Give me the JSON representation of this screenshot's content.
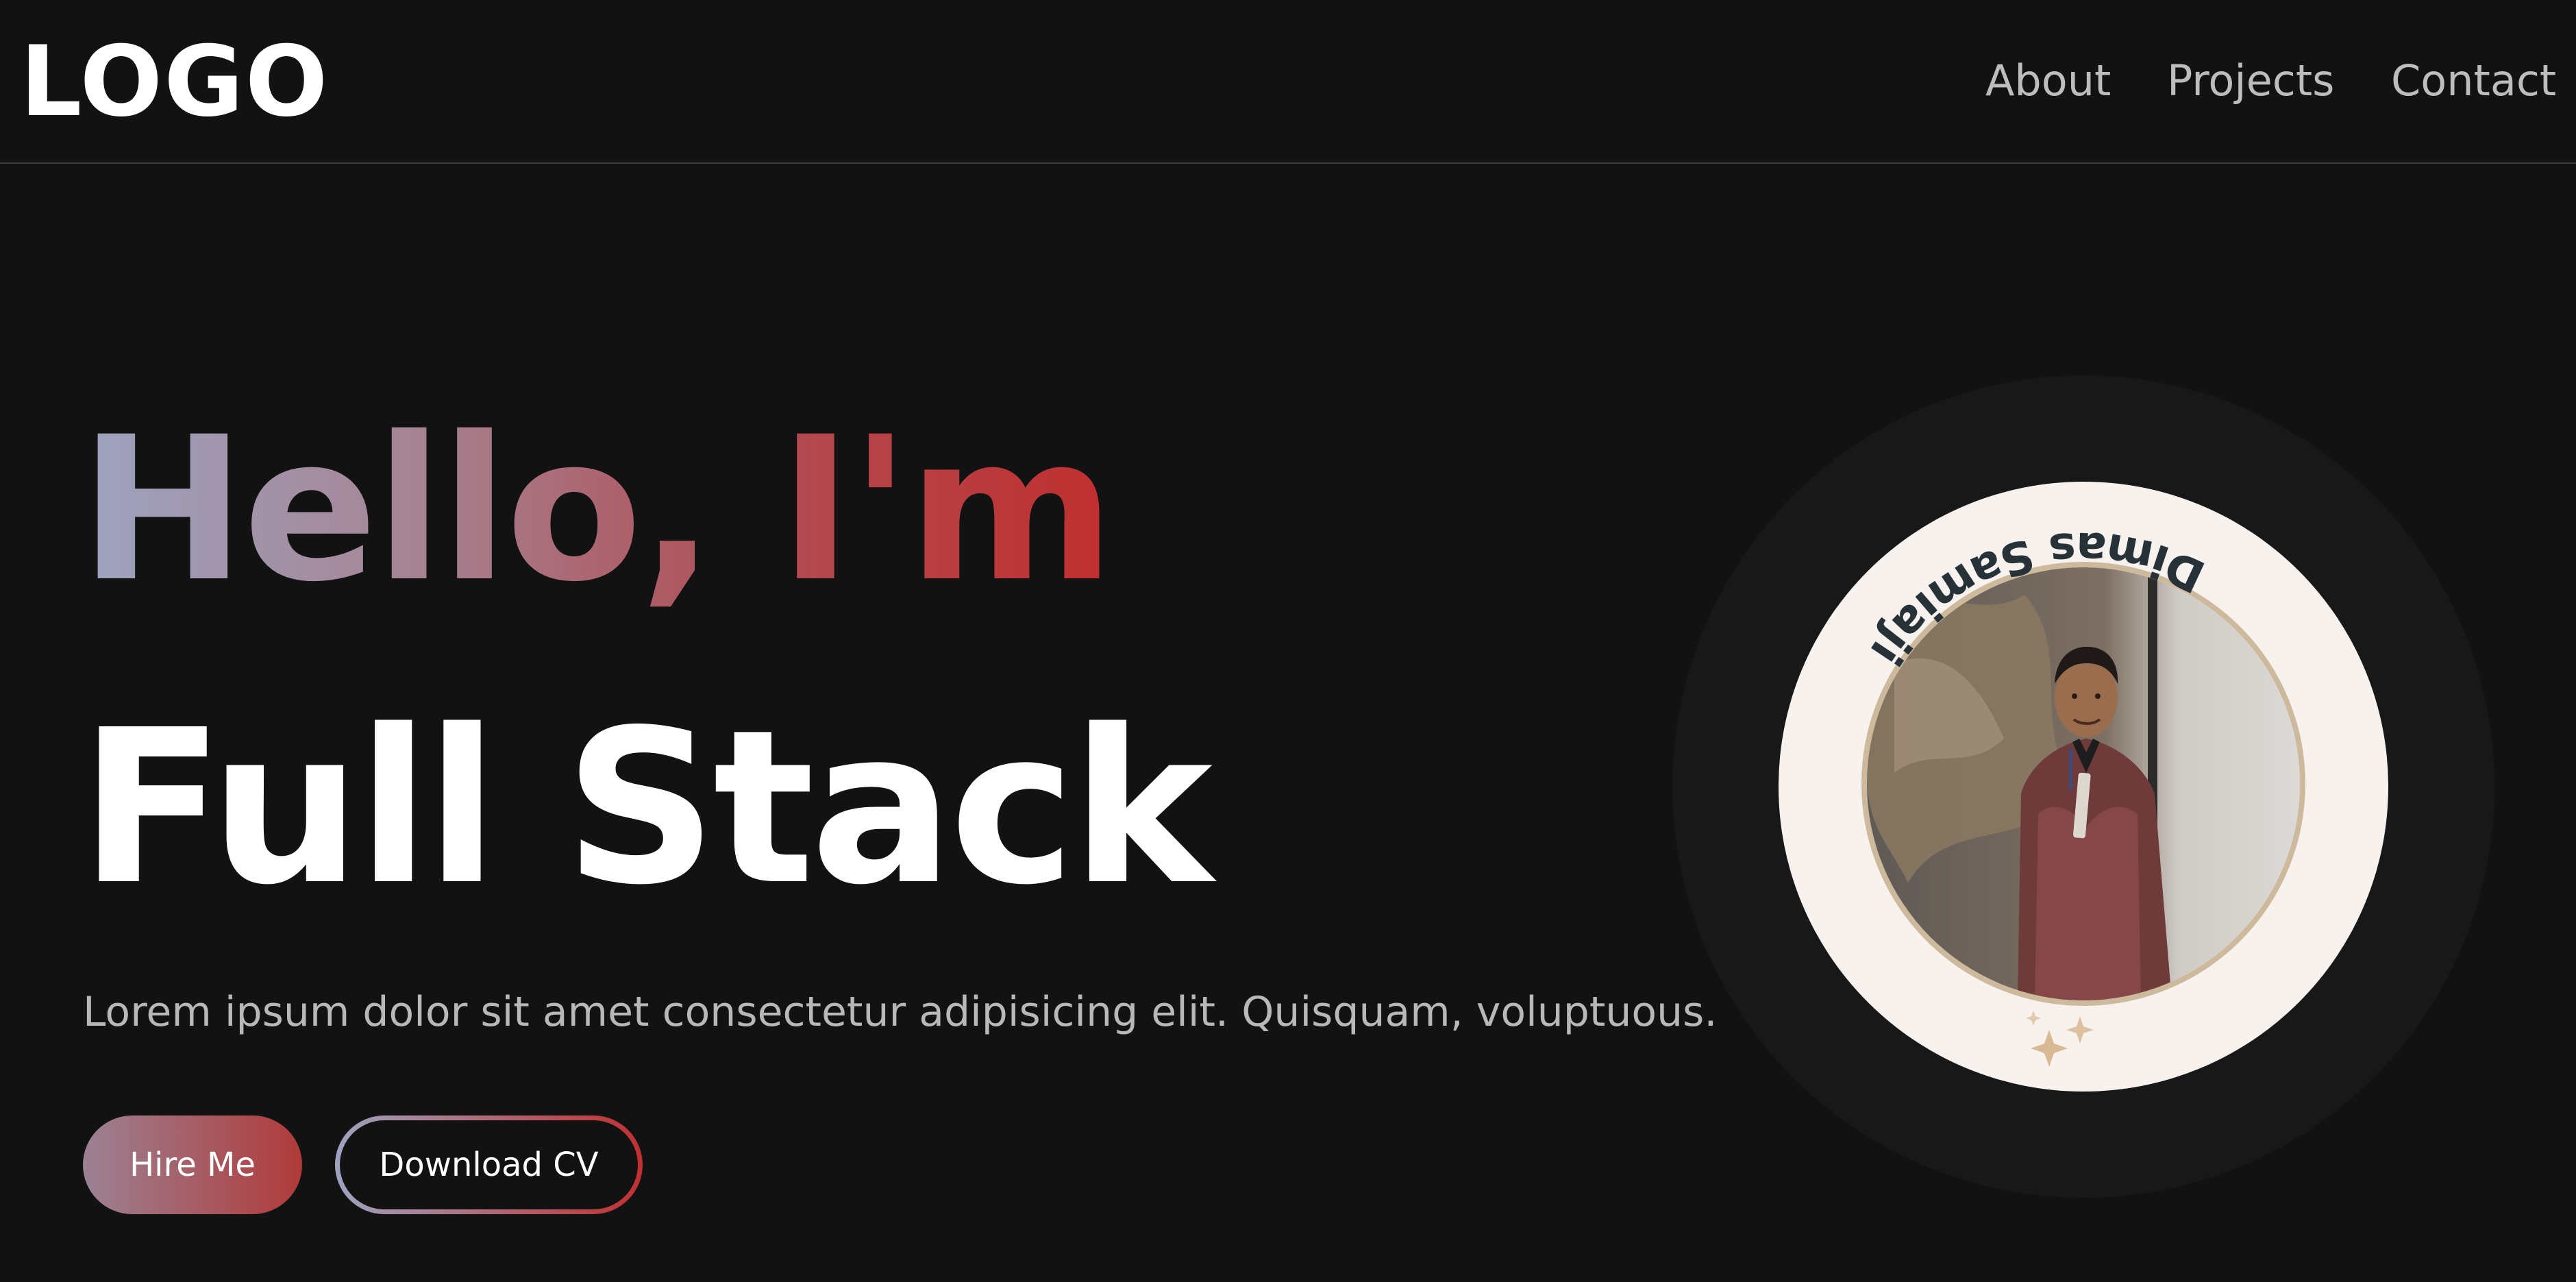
{
  "nav": {
    "logo": "LOGO",
    "links": [
      "About",
      "Projects",
      "Contact"
    ]
  },
  "hero": {
    "greeting": "Hello, I'm",
    "role": "Full Stack",
    "description": "Lorem ipsum dolor sit amet consectetur adipisicing elit. Quisquam, voluptuous.",
    "hire_label": "Hire Me",
    "cv_label": "Download CV"
  },
  "profile": {
    "name": "Dimas Samiaji"
  },
  "colors": {
    "background": "#121212",
    "accent_start": "#9ea3bf",
    "accent_end": "#c02f2f",
    "badge_bg": "#f8f2ef",
    "photo_ring": "#cdb99b"
  }
}
